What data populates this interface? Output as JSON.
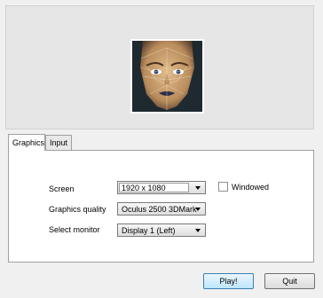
{
  "banner": {
    "image_name": "face-portrait"
  },
  "tabs": [
    {
      "label": "Graphics",
      "active": true
    },
    {
      "label": "Input",
      "active": false
    }
  ],
  "settings": {
    "screen": {
      "label": "Screen",
      "value": "1920 x 1080"
    },
    "windowed": {
      "label": "Windowed",
      "checked": false
    },
    "graphics_quality": {
      "label": "Graphics quality",
      "value": "Oculus 2500 3DMark"
    },
    "select_monitor": {
      "label": "Select monitor",
      "value": "Display 1 (Left)"
    }
  },
  "buttons": {
    "play": "Play!",
    "quit": "Quit"
  },
  "colors": {
    "primary_button_border": "#3c7fb1",
    "portrait_skin": "#c9a070",
    "portrait_background": "#1f2a30"
  }
}
